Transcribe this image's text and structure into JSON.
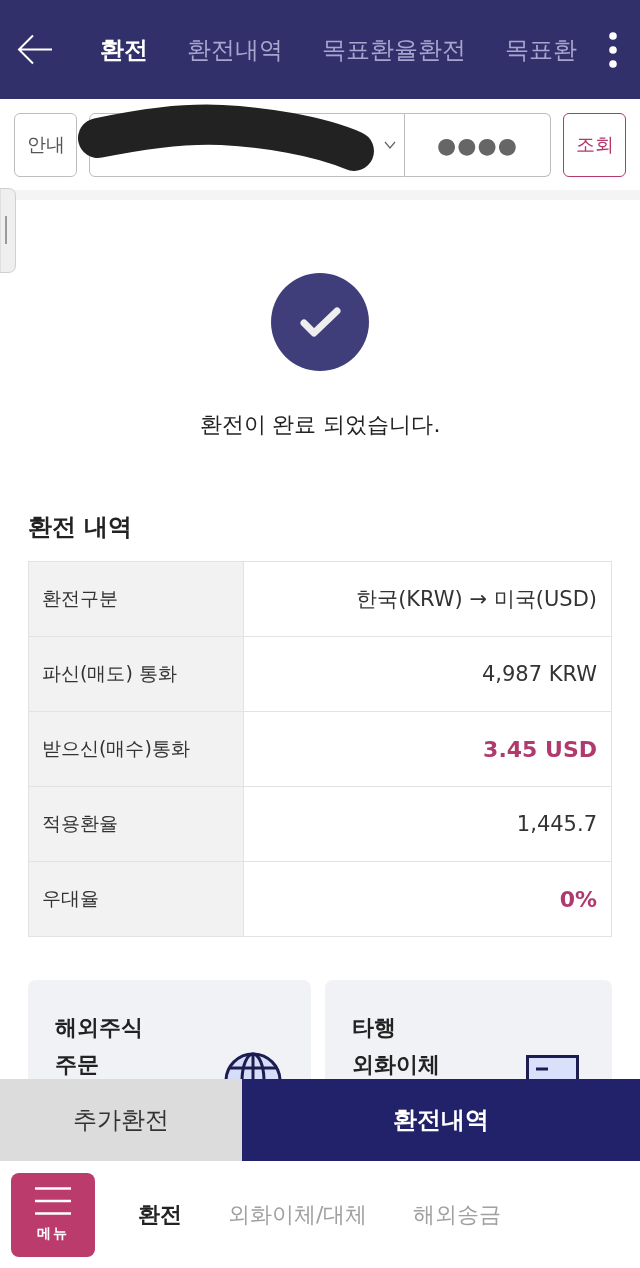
{
  "header": {
    "tabs": [
      {
        "label": "환전",
        "selected": true
      },
      {
        "label": "환전내역",
        "selected": false
      },
      {
        "label": "목표환율환전",
        "selected": false
      },
      {
        "label": "목표환",
        "selected": false
      }
    ]
  },
  "account_bar": {
    "guide_button": "안내",
    "password": {
      "value": "●●●●"
    },
    "lookup_button": "조회"
  },
  "result": {
    "message": "환전이 완료 되었습니다."
  },
  "details": {
    "title": "환전 내역",
    "rows": [
      {
        "label": "환전구분",
        "value": "한국(KRW) → 미국(USD)",
        "highlight": false
      },
      {
        "label": "파신(매도) 통화",
        "value": "4,987 KRW",
        "highlight": false
      },
      {
        "label": "받으신(매수)통화",
        "value": "3.45 USD",
        "highlight": true
      },
      {
        "label": "적용환율",
        "value": "1,445.7",
        "highlight": false
      },
      {
        "label": "우대율",
        "value": "0%",
        "highlight": true
      }
    ]
  },
  "shortcut_cards": [
    {
      "title": "해외주식\n주문"
    },
    {
      "title": "타행\n외화이체"
    }
  ],
  "action_bar": {
    "buttons": [
      {
        "label": "추가환전",
        "kind": "secondary"
      },
      {
        "label": "환전내역",
        "kind": "primary"
      }
    ]
  },
  "bottom_nav": {
    "menu_button": "메뉴",
    "items": [
      {
        "label": "환전",
        "selected": true
      },
      {
        "label": "외화이체/대체",
        "selected": false
      },
      {
        "label": "해외송금",
        "selected": false
      }
    ]
  }
}
